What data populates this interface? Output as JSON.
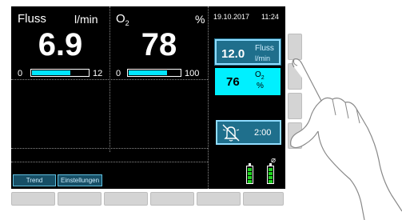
{
  "flow": {
    "label": "Fluss",
    "unit": "l/min",
    "value": "6.9",
    "range_min": "0",
    "range_max": "12",
    "level_percent": 69
  },
  "o2": {
    "label": "O",
    "label_sub": "2",
    "unit": "%",
    "value": "78",
    "range_min": "0",
    "range_max": "100",
    "level_percent": 76
  },
  "header": {
    "date": "19.10.2017",
    "time": "11:24"
  },
  "setpoints": {
    "flow": {
      "value": "12.0",
      "label": "Fluss",
      "unit": "l/min"
    },
    "o2": {
      "value": "76",
      "label": "O",
      "label_sub": "2",
      "unit": "%"
    }
  },
  "alarm": {
    "icon": "bell-muted-icon",
    "timer": "2:00"
  },
  "tabs": {
    "trend_label": "Trend",
    "settings_label": "Einstellungen"
  },
  "battery": {
    "icon": "battery-icon",
    "plug_icon": "plug-icon"
  },
  "colors": {
    "accent": "#00f0ff",
    "panel": "#1f6f8c",
    "battery": "#1fd01f",
    "background": "#000000"
  }
}
